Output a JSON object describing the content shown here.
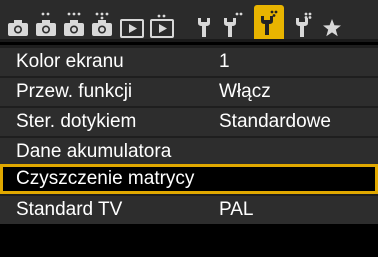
{
  "tabs": [
    {
      "icon": "camera-icon"
    },
    {
      "icon": "camera-icon"
    },
    {
      "icon": "camera-icon"
    },
    {
      "icon": "camera-icon"
    },
    {
      "icon": "playback-icon"
    },
    {
      "icon": "playback-icon"
    },
    {
      "icon": "wrench-icon"
    },
    {
      "icon": "wrench-icon"
    },
    {
      "icon": "wrench-icon",
      "active": true
    },
    {
      "icon": "wrench-icon"
    },
    {
      "icon": "star-icon"
    }
  ],
  "menu": {
    "items": [
      {
        "label": "Kolor ekranu",
        "value": "1"
      },
      {
        "label": "Przew. funkcji",
        "value": "Włącz"
      },
      {
        "label": "Ster. dotykiem",
        "value": "Standardowe"
      },
      {
        "label": "Dane akumulatora",
        "value": ""
      },
      {
        "label": "Czyszczenie matrycy",
        "value": "",
        "selected": true
      },
      {
        "label": "Standard TV",
        "value": "PAL"
      }
    ]
  },
  "colors": {
    "accent": "#e8b400",
    "tab_bar": "#2b2b2b",
    "row_bg": "#2d2d2d",
    "selected_border": "#e0a800"
  }
}
